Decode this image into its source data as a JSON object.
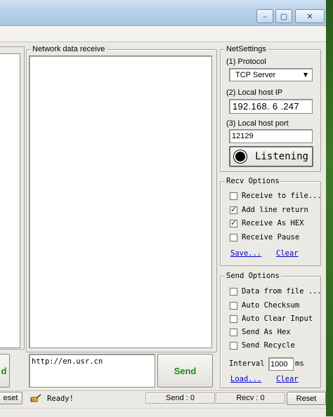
{
  "window": {
    "minimize_glyph": "–",
    "maximize_glyph": "▢",
    "close_glyph": "✕"
  },
  "network_receive": {
    "title": "Network data receive"
  },
  "net_settings": {
    "title": "NetSettings",
    "protocol_label": "(1) Protocol",
    "protocol_value": "TCP Server",
    "host_ip_label": "(2) Local host IP",
    "host_ip_value": "192.168. 6 .247",
    "host_port_label": "(3) Local host port",
    "host_port_value": "12129",
    "listen_button": "Listening"
  },
  "recv_options": {
    "title": "Recv Options",
    "items": [
      {
        "label": "Receive to file...",
        "checked": false
      },
      {
        "label": "Add line return",
        "checked": true
      },
      {
        "label": "Receive As HEX",
        "checked": true
      },
      {
        "label": "Receive Pause",
        "checked": false
      }
    ],
    "save_link": "Save...",
    "clear_link": "Clear"
  },
  "send_options": {
    "title": "Send Options",
    "items": [
      {
        "label": "Data from file ...",
        "checked": false
      },
      {
        "label": "Auto Checksum",
        "checked": false
      },
      {
        "label": "Auto Clear Input",
        "checked": false
      },
      {
        "label": "Send As Hex",
        "checked": false
      },
      {
        "label": "Send Recycle",
        "checked": false
      }
    ],
    "interval_label": "Interval",
    "interval_value": "1000",
    "interval_unit": "ms",
    "load_link": "Load...",
    "clear_link": "Clear"
  },
  "send_area": {
    "input_value": "http://en.usr.cn",
    "send_button": "Send",
    "partial_button_text": "d"
  },
  "status_bar": {
    "left_partial_button": "eset",
    "ready_text": "Ready!",
    "send_count": "Send : 0",
    "recv_count": "Recv : 0",
    "reset_button": "Reset"
  },
  "colors": {
    "send_text": "#1b8a1b",
    "link": "#0000d0",
    "titlebar": "#b9d1ea"
  }
}
